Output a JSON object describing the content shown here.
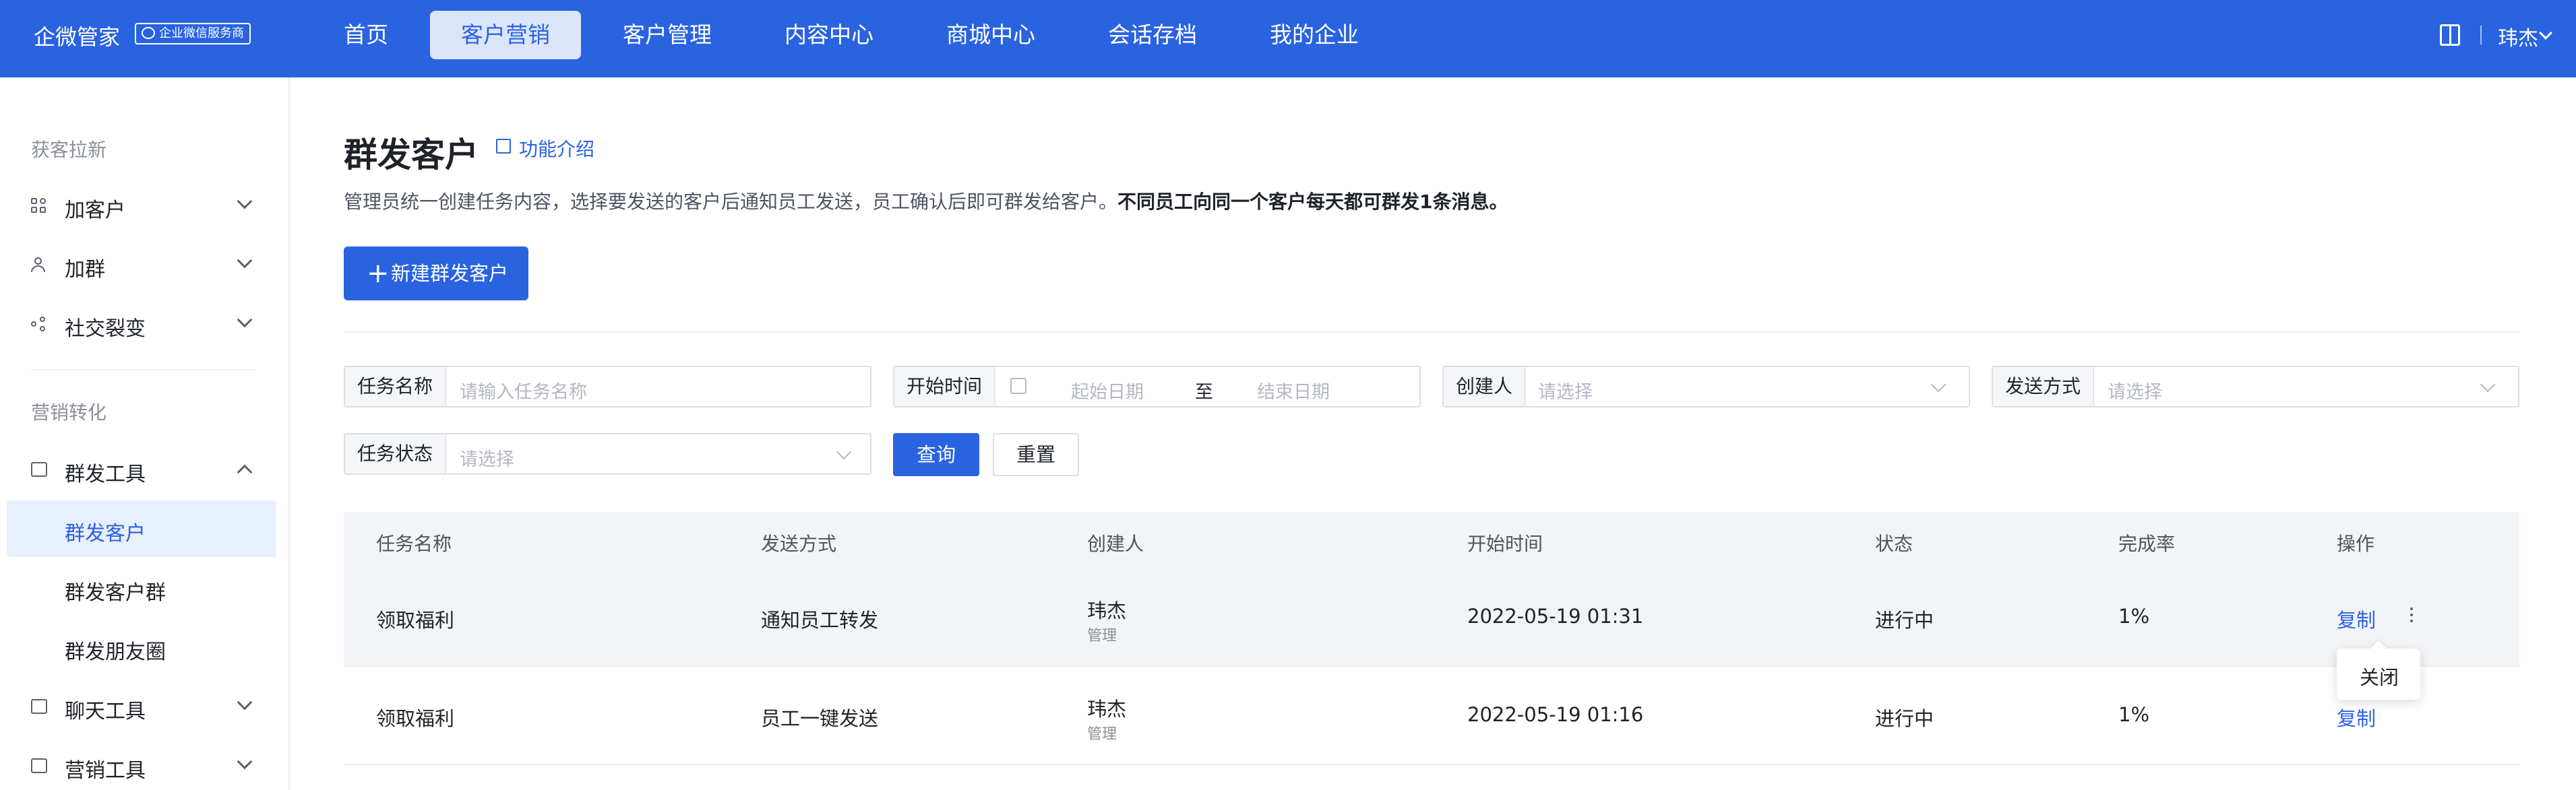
{
  "brand": {
    "name": "企微管家",
    "badge": "企业微信服务商"
  },
  "nav": {
    "items": [
      {
        "label": "首页"
      },
      {
        "label": "客户营销",
        "active": true
      },
      {
        "label": "客户管理"
      },
      {
        "label": "内容中心"
      },
      {
        "label": "商城中心"
      },
      {
        "label": "会话存档"
      },
      {
        "label": "我的企业"
      }
    ],
    "user": "玮杰"
  },
  "sidebar": {
    "groups": [
      "获客拉新",
      "营销转化"
    ],
    "items": [
      {
        "label": "加客户",
        "icon": "grid-icon"
      },
      {
        "label": "加群",
        "icon": "person-icon"
      },
      {
        "label": "社交裂变",
        "icon": "share-icon"
      },
      {
        "label": "群发工具",
        "icon": "send-icon",
        "expanded": true
      },
      {
        "label": "聊天工具",
        "icon": "chat-icon"
      },
      {
        "label": "营销工具",
        "icon": "chart-icon"
      }
    ],
    "sub_items": [
      {
        "label": "群发客户",
        "active": true
      },
      {
        "label": "群发客户群"
      },
      {
        "label": "群发朋友圈"
      }
    ]
  },
  "page": {
    "title": "群发客户",
    "intro_link": "功能介绍",
    "desc_normal": "管理员统一创建任务内容，选择要发送的客户后通知员工发送，员工确认后即可群发给客户。",
    "desc_bold": "不同员工向同一个客户每天都可群发1条消息。",
    "new_button": "新建群发客户"
  },
  "filters": {
    "task_name": {
      "label": "任务名称",
      "placeholder": "请输入任务名称"
    },
    "start_time": {
      "label": "开始时间",
      "start_placeholder": "起始日期",
      "separator": "至",
      "end_placeholder": "结束日期"
    },
    "creator": {
      "label": "创建人",
      "placeholder": "请选择"
    },
    "send_method": {
      "label": "发送方式",
      "placeholder": "请选择"
    },
    "task_status": {
      "label": "任务状态",
      "placeholder": "请选择"
    },
    "query_button": "查询",
    "reset_button": "重置"
  },
  "table": {
    "columns": [
      "任务名称",
      "发送方式",
      "创建人",
      "开始时间",
      "状态",
      "完成率",
      "操作"
    ],
    "rows": [
      {
        "name": "领取福利",
        "method": "通知员工转发",
        "creator": "玮杰",
        "creator_role": "管理",
        "start": "2022-05-19 01:31",
        "status": "进行中",
        "rate": "1%",
        "action": "复制"
      },
      {
        "name": "领取福利",
        "method": "员工一键发送",
        "creator": "玮杰",
        "creator_role": "管理",
        "start": "2022-05-19 01:16",
        "status": "进行中",
        "rate": "1%",
        "action": "复制"
      }
    ],
    "popover_item": "关闭"
  }
}
